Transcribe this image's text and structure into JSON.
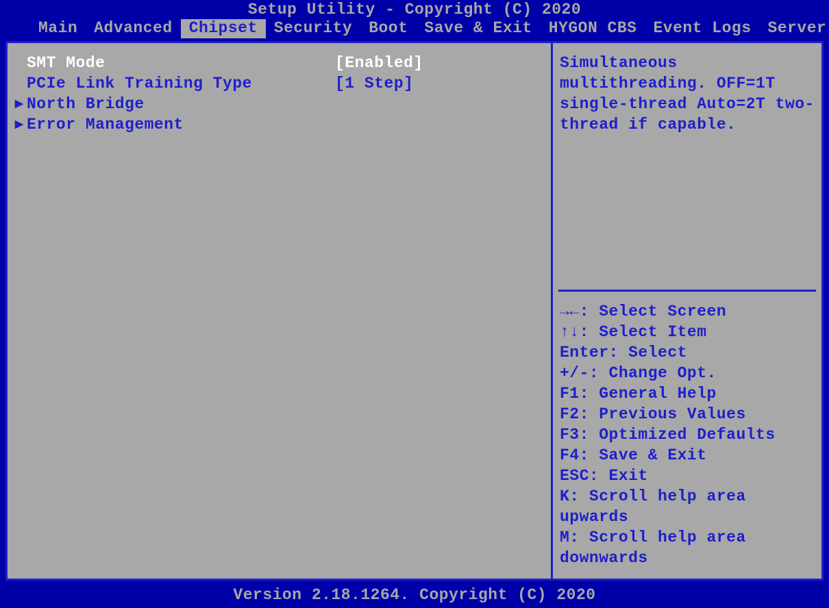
{
  "header": {
    "title": "Setup Utility - Copyright (C) 2020"
  },
  "menu": {
    "items": [
      {
        "label": "Main"
      },
      {
        "label": "Advanced"
      },
      {
        "label": "Chipset",
        "active": true
      },
      {
        "label": "Security"
      },
      {
        "label": "Boot"
      },
      {
        "label": "Save & Exit"
      },
      {
        "label": "HYGON CBS"
      },
      {
        "label": "Event Logs"
      },
      {
        "label": "Server Mgmt"
      }
    ]
  },
  "main": {
    "rows": [
      {
        "type": "option",
        "label": "SMT Mode",
        "value": "[Enabled]",
        "selected": true
      },
      {
        "type": "option",
        "label": "PCIe Link Training Type",
        "value": "[1 Step]"
      },
      {
        "type": "submenu",
        "label": "North Bridge"
      },
      {
        "type": "submenu",
        "label": "Error Management"
      }
    ]
  },
  "help": {
    "text": "Simultaneous multithreading. OFF=1T single-thread Auto=2T two-thread if capable."
  },
  "keys": [
    "→←: Select Screen",
    "↑↓: Select Item",
    "Enter: Select",
    "+/-: Change Opt.",
    "F1: General Help",
    "F2: Previous Values",
    "F3: Optimized Defaults",
    "F4: Save & Exit",
    "ESC: Exit",
    "K: Scroll help area upwards",
    "M: Scroll help area downwards"
  ],
  "footer": {
    "text": "Version 2.18.1264. Copyright (C) 2020"
  }
}
